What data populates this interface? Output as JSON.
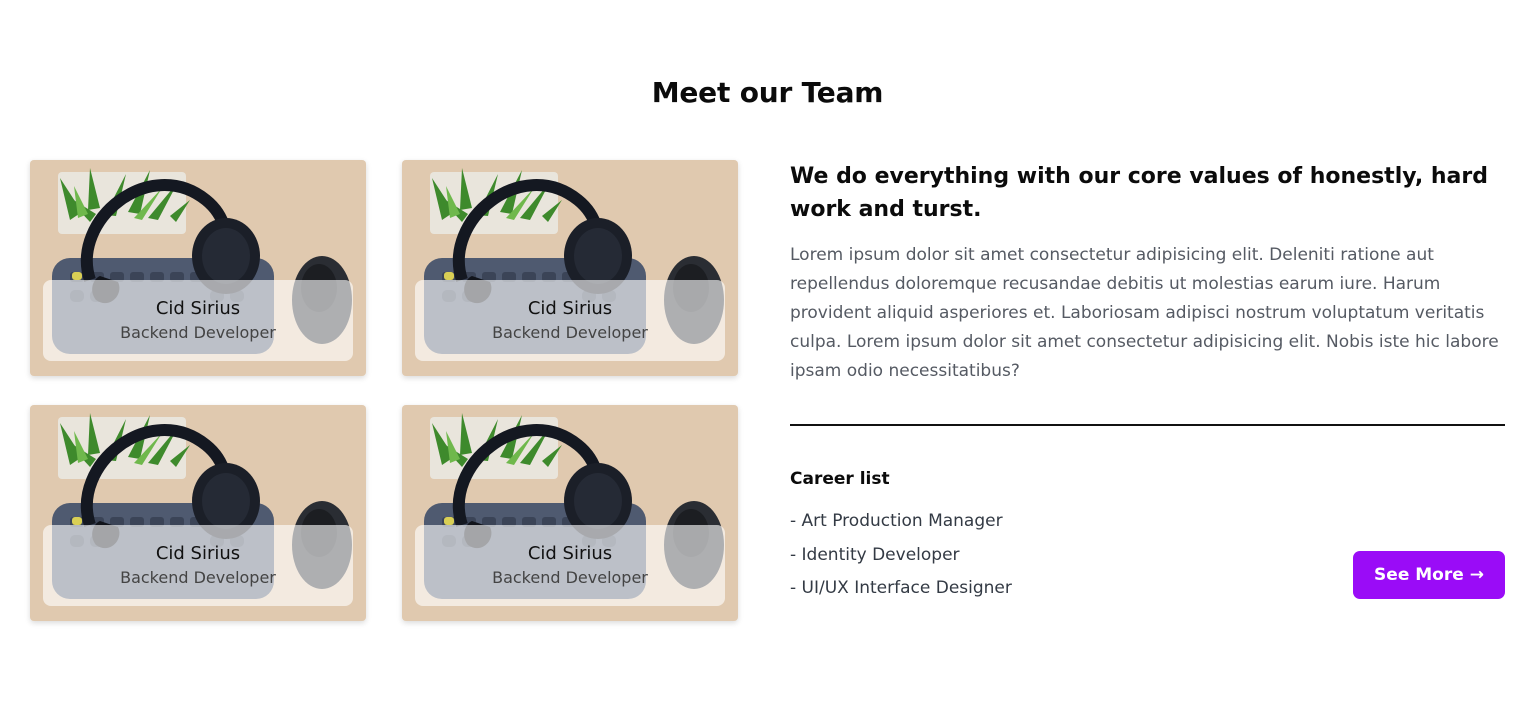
{
  "section": {
    "title": "Meet our Team"
  },
  "team": [
    {
      "name": "Cid Sirius",
      "role": "Backend Developer",
      "photo_icon": "desk-headphones-photo"
    },
    {
      "name": "Cid Sirius",
      "role": "Backend Developer",
      "photo_icon": "desk-headphones-photo"
    },
    {
      "name": "Cid Sirius",
      "role": "Backend Developer",
      "photo_icon": "desk-headphones-photo"
    },
    {
      "name": "Cid Sirius",
      "role": "Backend Developer",
      "photo_icon": "desk-headphones-photo"
    }
  ],
  "about": {
    "headline": "We do everything with our core values of honestly, hard work and turst.",
    "paragraph": "Lorem ipsum dolor sit amet consectetur adipisicing elit. Deleniti ratione aut repellendus doloremque recusandae debitis ut molestias earum iure. Harum provident aliquid asperiores et. Laboriosam adipisci nostrum voluptatum veritatis culpa. Lorem ipsum dolor sit amet consectetur adipisicing elit. Nobis iste hic labore ipsam odio necessitatibus?"
  },
  "career": {
    "title": "Career list",
    "items": [
      "- Art Production Manager",
      "- Identity Developer",
      "- UI/UX Interface Designer"
    ],
    "button_label": "See More →"
  },
  "colors": {
    "accent": "#9a0cf7",
    "text": "#0b0b0b",
    "muted": "#555a63"
  }
}
